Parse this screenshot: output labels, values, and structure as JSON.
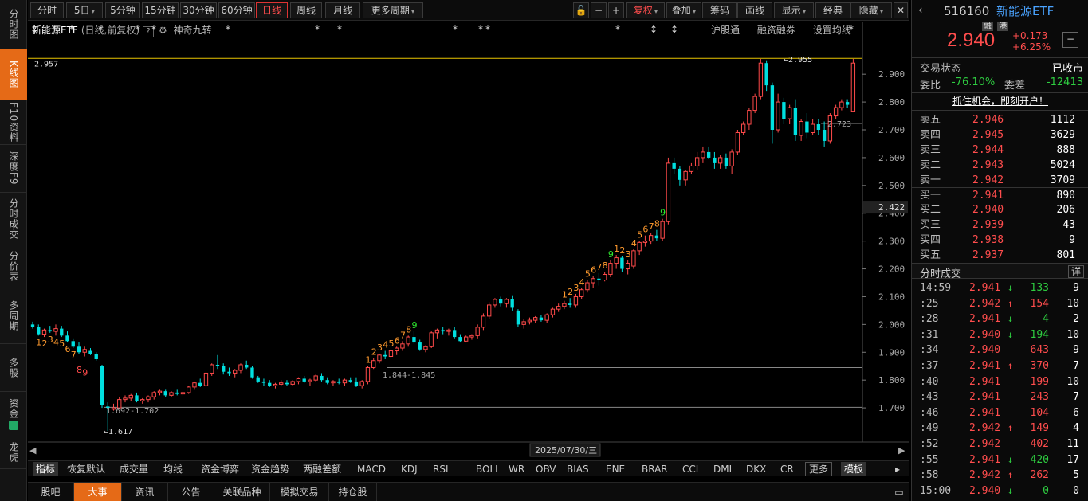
{
  "leftnav": [
    {
      "label": "分时图",
      "active": false,
      "h": 62
    },
    {
      "label": "K线图",
      "active": true,
      "h": 64
    },
    {
      "label": "F10资料",
      "active": false,
      "h": 56
    },
    {
      "label": "深度F9",
      "active": false,
      "h": 60
    },
    {
      "label": "分时成交",
      "active": false,
      "h": 66
    },
    {
      "label": "分价表",
      "active": false,
      "h": 54
    },
    {
      "label": "多周期",
      "active": false,
      "h": 70
    },
    {
      "label": "多股",
      "active": false,
      "h": 60
    },
    {
      "label": "资金",
      "active": false,
      "h": 56
    },
    {
      "label": "龙虎",
      "active": false,
      "h": 41
    }
  ],
  "toolbar": {
    "periods": [
      "分时",
      "5日",
      "5分钟",
      "15分钟",
      "30分钟",
      "60分钟",
      "日线",
      "周线",
      "月线",
      "更多周期"
    ],
    "active_period": "日线",
    "tools": [
      "复权",
      "叠加",
      "筹码",
      "画线",
      "显示",
      "经典",
      "隐藏"
    ]
  },
  "header": {
    "title": "新能源ETF",
    "subtitle": "(日线,前复权)",
    "help": "?",
    "feature": "神奇九转",
    "links": [
      "沪股通",
      "融资融券",
      "设置均线"
    ]
  },
  "chart_data": {
    "type": "candlestick",
    "ylim": [
      1.6,
      2.975
    ],
    "y_ticks": [
      1.7,
      1.8,
      1.9,
      2.0,
      2.1,
      2.2,
      2.3,
      2.4,
      2.5,
      2.6,
      2.7,
      2.8,
      2.9
    ],
    "current_price_label": "2.422",
    "max_label": "2.957",
    "x_label": "2025/07/30/三",
    "annotations": [
      {
        "text": "2.955",
        "type": "high"
      },
      {
        "text": "1.617",
        "type": "low"
      },
      {
        "text": "1.692-1.702",
        "type": "range"
      },
      {
        "text": "1.844-1.845",
        "type": "range"
      },
      {
        "text": "2.723",
        "type": "level"
      }
    ],
    "ohlc": [
      [
        2.0,
        2.01,
        1.985,
        1.99
      ],
      [
        1.99,
        2.0,
        1.96,
        1.965
      ],
      [
        1.965,
        1.985,
        1.955,
        1.98
      ],
      [
        1.98,
        1.995,
        1.97,
        1.975
      ],
      [
        1.975,
        2.0,
        1.96,
        1.985
      ],
      [
        1.985,
        1.995,
        1.955,
        1.96
      ],
      [
        1.96,
        1.975,
        1.935,
        1.94
      ],
      [
        1.94,
        1.95,
        1.915,
        1.92
      ],
      [
        1.92,
        1.935,
        1.895,
        1.9
      ],
      [
        1.9,
        1.92,
        1.885,
        1.91
      ],
      [
        1.905,
        1.915,
        1.89,
        1.895
      ],
      [
        1.895,
        1.9,
        1.87,
        1.875
      ],
      [
        1.85,
        1.855,
        1.7,
        1.71
      ],
      [
        1.705,
        1.72,
        1.617,
        1.7
      ],
      [
        1.695,
        1.715,
        1.69,
        1.7
      ],
      [
        1.7,
        1.74,
        1.695,
        1.73
      ],
      [
        1.73,
        1.745,
        1.72,
        1.735
      ],
      [
        1.735,
        1.75,
        1.725,
        1.745
      ],
      [
        1.745,
        1.755,
        1.72,
        1.725
      ],
      [
        1.725,
        1.735,
        1.715,
        1.73
      ],
      [
        1.73,
        1.745,
        1.72,
        1.74
      ],
      [
        1.74,
        1.76,
        1.73,
        1.755
      ],
      [
        1.755,
        1.765,
        1.745,
        1.76
      ],
      [
        1.76,
        1.765,
        1.74,
        1.745
      ],
      [
        1.745,
        1.76,
        1.74,
        1.755
      ],
      [
        1.755,
        1.765,
        1.745,
        1.75
      ],
      [
        1.75,
        1.76,
        1.742,
        1.755
      ],
      [
        1.755,
        1.78,
        1.75,
        1.775
      ],
      [
        1.775,
        1.795,
        1.765,
        1.79
      ],
      [
        1.79,
        1.805,
        1.775,
        1.78
      ],
      [
        1.78,
        1.83,
        1.775,
        1.825
      ],
      [
        1.825,
        1.86,
        1.815,
        1.855
      ],
      [
        1.855,
        1.89,
        1.84,
        1.85
      ],
      [
        1.85,
        1.86,
        1.82,
        1.83
      ],
      [
        1.83,
        1.845,
        1.815,
        1.825
      ],
      [
        1.825,
        1.84,
        1.81,
        1.835
      ],
      [
        1.835,
        1.86,
        1.825,
        1.855
      ],
      [
        1.855,
        1.87,
        1.84,
        1.845
      ],
      [
        1.845,
        1.85,
        1.805,
        1.81
      ],
      [
        1.81,
        1.815,
        1.79,
        1.795
      ],
      [
        1.795,
        1.805,
        1.78,
        1.79
      ],
      [
        1.79,
        1.8,
        1.775,
        1.78
      ],
      [
        1.78,
        1.79,
        1.77,
        1.785
      ],
      [
        1.785,
        1.8,
        1.778,
        1.79
      ],
      [
        1.79,
        1.8,
        1.78,
        1.785
      ],
      [
        1.785,
        1.8,
        1.778,
        1.795
      ],
      [
        1.795,
        1.81,
        1.785,
        1.805
      ],
      [
        1.805,
        1.815,
        1.79,
        1.795
      ],
      [
        1.795,
        1.805,
        1.78,
        1.8
      ],
      [
        1.8,
        1.82,
        1.795,
        1.815
      ],
      [
        1.815,
        1.825,
        1.795,
        1.8
      ],
      [
        1.8,
        1.81,
        1.785,
        1.79
      ],
      [
        1.79,
        1.8,
        1.78,
        1.795
      ],
      [
        1.795,
        1.805,
        1.785,
        1.79
      ],
      [
        1.79,
        1.805,
        1.78,
        1.8
      ],
      [
        1.8,
        1.81,
        1.79,
        1.795
      ],
      [
        1.795,
        1.81,
        1.775,
        1.78
      ],
      [
        1.78,
        1.8,
        1.77,
        1.795
      ],
      [
        1.795,
        1.85,
        1.785,
        1.845
      ],
      [
        1.845,
        1.88,
        1.84,
        1.87
      ],
      [
        1.87,
        1.895,
        1.86,
        1.89
      ],
      [
        1.89,
        1.905,
        1.875,
        1.885
      ],
      [
        1.885,
        1.91,
        1.88,
        1.905
      ],
      [
        1.905,
        1.92,
        1.89,
        1.915
      ],
      [
        1.915,
        1.94,
        1.905,
        1.93
      ],
      [
        1.93,
        1.96,
        1.92,
        1.955
      ],
      [
        1.955,
        1.975,
        1.93,
        1.935
      ],
      [
        1.935,
        1.945,
        1.905,
        1.91
      ],
      [
        1.91,
        1.925,
        1.9,
        1.92
      ],
      [
        1.92,
        1.975,
        1.915,
        1.97
      ],
      [
        1.97,
        1.985,
        1.95,
        1.98
      ],
      [
        1.98,
        1.99,
        1.965,
        1.975
      ],
      [
        1.975,
        1.985,
        1.96,
        1.98
      ],
      [
        1.98,
        1.99,
        1.95,
        1.955
      ],
      [
        1.955,
        1.965,
        1.935,
        1.94
      ],
      [
        1.94,
        1.96,
        1.935,
        1.955
      ],
      [
        1.955,
        1.965,
        1.945,
        1.96
      ],
      [
        1.96,
        2.0,
        1.95,
        1.99
      ],
      [
        1.99,
        2.04,
        1.98,
        2.03
      ],
      [
        2.03,
        2.08,
        2.02,
        2.07
      ],
      [
        2.07,
        2.095,
        2.06,
        2.09
      ],
      [
        2.09,
        2.1,
        2.065,
        2.075
      ],
      [
        2.075,
        2.095,
        2.06,
        2.09
      ],
      [
        2.09,
        2.105,
        2.05,
        2.06
      ],
      [
        2.05,
        2.055,
        1.99,
        2.0
      ],
      [
        2.0,
        2.02,
        1.985,
        2.01
      ],
      [
        2.01,
        2.025,
        2.0,
        2.015
      ],
      [
        2.015,
        2.03,
        2.005,
        2.025
      ],
      [
        2.025,
        2.035,
        2.01,
        2.015
      ],
      [
        2.015,
        2.04,
        2.005,
        2.035
      ],
      [
        2.035,
        2.06,
        2.025,
        2.055
      ],
      [
        2.055,
        2.075,
        2.045,
        2.065
      ],
      [
        2.065,
        2.085,
        2.055,
        2.075
      ],
      [
        2.075,
        2.095,
        2.06,
        2.07
      ],
      [
        2.07,
        2.11,
        2.06,
        2.1
      ],
      [
        2.1,
        2.13,
        2.09,
        2.125
      ],
      [
        2.125,
        2.16,
        2.115,
        2.15
      ],
      [
        2.15,
        2.175,
        2.13,
        2.165
      ],
      [
        2.165,
        2.185,
        2.14,
        2.16
      ],
      [
        2.16,
        2.19,
        2.155,
        2.18
      ],
      [
        2.18,
        2.23,
        2.17,
        2.22
      ],
      [
        2.22,
        2.25,
        2.2,
        2.24
      ],
      [
        2.24,
        2.245,
        2.19,
        2.2
      ],
      [
        2.2,
        2.23,
        2.18,
        2.22
      ],
      [
        2.21,
        2.27,
        2.2,
        2.265
      ],
      [
        2.265,
        2.3,
        2.25,
        2.295
      ],
      [
        2.295,
        2.32,
        2.28,
        2.3
      ],
      [
        2.3,
        2.33,
        2.29,
        2.32
      ],
      [
        2.32,
        2.34,
        2.3,
        2.31
      ],
      [
        2.31,
        2.38,
        2.3,
        2.37
      ],
      [
        2.37,
        2.6,
        2.36,
        2.58
      ],
      [
        2.58,
        2.6,
        2.54,
        2.56
      ],
      [
        2.56,
        2.57,
        2.5,
        2.52
      ],
      [
        2.52,
        2.555,
        2.5,
        2.55
      ],
      [
        2.55,
        2.58,
        2.54,
        2.57
      ],
      [
        2.57,
        2.62,
        2.555,
        2.6
      ],
      [
        2.6,
        2.64,
        2.58,
        2.62
      ],
      [
        2.62,
        2.64,
        2.595,
        2.6
      ],
      [
        2.6,
        2.62,
        2.56,
        2.58
      ],
      [
        2.58,
        2.61,
        2.56,
        2.6
      ],
      [
        2.6,
        2.615,
        2.56,
        2.57
      ],
      [
        2.57,
        2.63,
        2.54,
        2.62
      ],
      [
        2.62,
        2.7,
        2.61,
        2.69
      ],
      [
        2.69,
        2.73,
        2.68,
        2.72
      ],
      [
        2.72,
        2.78,
        2.7,
        2.77
      ],
      [
        2.77,
        2.83,
        2.76,
        2.82
      ],
      [
        2.82,
        2.955,
        2.81,
        2.94
      ],
      [
        2.94,
        2.95,
        2.84,
        2.86
      ],
      [
        2.86,
        2.87,
        2.65,
        2.7
      ],
      [
        2.7,
        2.83,
        2.69,
        2.8
      ],
      [
        2.8,
        2.815,
        2.72,
        2.74
      ],
      [
        2.74,
        2.79,
        2.72,
        2.78
      ],
      [
        2.78,
        2.81,
        2.66,
        2.68
      ],
      [
        2.68,
        2.74,
        2.66,
        2.73
      ],
      [
        2.73,
        2.76,
        2.67,
        2.69
      ],
      [
        2.69,
        2.74,
        2.68,
        2.72
      ],
      [
        2.72,
        2.74,
        2.68,
        2.7
      ],
      [
        2.7,
        2.73,
        2.64,
        2.66
      ],
      [
        2.66,
        2.76,
        2.65,
        2.75
      ],
      [
        2.75,
        2.79,
        2.74,
        2.78
      ],
      [
        2.78,
        2.81,
        2.77,
        2.8
      ],
      [
        2.8,
        2.81,
        2.78,
        2.79
      ],
      [
        2.767,
        2.955,
        2.767,
        2.94
      ]
    ],
    "nine_turn": [
      {
        "i": 1,
        "t": "1",
        "c": "o"
      },
      {
        "i": 2,
        "t": "2",
        "c": "o"
      },
      {
        "i": 3,
        "t": "3",
        "c": "o"
      },
      {
        "i": 4,
        "t": "4",
        "c": "o"
      },
      {
        "i": 5,
        "t": "5",
        "c": "o"
      },
      {
        "i": 6,
        "t": "6",
        "c": "o"
      },
      {
        "i": 7,
        "t": "7",
        "c": "o"
      },
      {
        "i": 8,
        "t": "8",
        "c": "r"
      },
      {
        "i": 9,
        "t": "9",
        "c": "r"
      },
      {
        "i": 58,
        "t": "1",
        "c": "o"
      },
      {
        "i": 59,
        "t": "2",
        "c": "o"
      },
      {
        "i": 60,
        "t": "3",
        "c": "o"
      },
      {
        "i": 61,
        "t": "4",
        "c": "o"
      },
      {
        "i": 62,
        "t": "5",
        "c": "o"
      },
      {
        "i": 63,
        "t": "6",
        "c": "o"
      },
      {
        "i": 64,
        "t": "7",
        "c": "o"
      },
      {
        "i": 65,
        "t": "8",
        "c": "o"
      },
      {
        "i": 66,
        "t": "9",
        "c": "g"
      },
      {
        "i": 92,
        "t": "1",
        "c": "o"
      },
      {
        "i": 93,
        "t": "2",
        "c": "o"
      },
      {
        "i": 94,
        "t": "3",
        "c": "o"
      },
      {
        "i": 95,
        "t": "4",
        "c": "o"
      },
      {
        "i": 96,
        "t": "5",
        "c": "o"
      },
      {
        "i": 97,
        "t": "6",
        "c": "o"
      },
      {
        "i": 98,
        "t": "7",
        "c": "o"
      },
      {
        "i": 99,
        "t": "8",
        "c": "o"
      },
      {
        "i": 100,
        "t": "9",
        "c": "g"
      },
      {
        "i": 101,
        "t": "1",
        "c": "o"
      },
      {
        "i": 102,
        "t": "2",
        "c": "o"
      },
      {
        "i": 103,
        "t": "3",
        "c": "o"
      },
      {
        "i": 104,
        "t": "4",
        "c": "o"
      },
      {
        "i": 105,
        "t": "5",
        "c": "o"
      },
      {
        "i": 106,
        "t": "6",
        "c": "o"
      },
      {
        "i": 107,
        "t": "7",
        "c": "o"
      },
      {
        "i": 108,
        "t": "8",
        "c": "o"
      },
      {
        "i": 109,
        "t": "9",
        "c": "g"
      }
    ]
  },
  "indicators": [
    "指标",
    "恢复默认",
    "成交量",
    "均线",
    "资金博弈",
    "资金趋势",
    "两融差额",
    "MACD",
    "KDJ",
    "RSI",
    "BOLL",
    "WR",
    "OBV",
    "BIAS",
    "ENE",
    "BRAR",
    "CCI",
    "DMI",
    "DKX",
    "CR",
    "更多",
    "模板"
  ],
  "bottom_tabs": [
    "股吧",
    "大事",
    "资讯",
    "公告",
    "关联品种",
    "模拟交易",
    "持仓股"
  ],
  "active_bottom_tab": "大事",
  "quote": {
    "code": "516160",
    "name": "新能源ETF",
    "badges": [
      "融",
      "港"
    ],
    "price": "2.940",
    "change": "+0.173",
    "change_pct": "+6.25%",
    "status_label": "交易状态",
    "status": "已收市",
    "ratio_label": "委比",
    "ratio": "-76.10%",
    "diff_label": "委差",
    "diff": "-12413",
    "promo": "抓住机会，即刻开户！"
  },
  "orderbook": [
    {
      "label": "卖五",
      "price": "2.946",
      "vol": "1112"
    },
    {
      "label": "卖四",
      "price": "2.945",
      "vol": "3629"
    },
    {
      "label": "卖三",
      "price": "2.944",
      "vol": "888"
    },
    {
      "label": "卖二",
      "price": "2.943",
      "vol": "5024"
    },
    {
      "label": "卖一",
      "price": "2.942",
      "vol": "3709"
    },
    {
      "label": "买一",
      "price": "2.941",
      "vol": "890"
    },
    {
      "label": "买二",
      "price": "2.940",
      "vol": "206"
    },
    {
      "label": "买三",
      "price": "2.939",
      "vol": "43"
    },
    {
      "label": "买四",
      "price": "2.938",
      "vol": "9"
    },
    {
      "label": "买五",
      "price": "2.937",
      "vol": "801"
    }
  ],
  "trades_header": {
    "title": "分时成交",
    "more": "详"
  },
  "trades": [
    {
      "time": "14:59",
      "price": "2.941",
      "dir": "down",
      "vol": "133",
      "n": "9"
    },
    {
      "time": ":25",
      "price": "2.942",
      "dir": "up",
      "vol": "154",
      "n": "10"
    },
    {
      "time": ":28",
      "price": "2.941",
      "dir": "down",
      "vol": "4",
      "n": "2"
    },
    {
      "time": ":31",
      "price": "2.940",
      "dir": "down",
      "vol": "194",
      "n": "10"
    },
    {
      "time": ":34",
      "price": "2.940",
      "dir": "none",
      "vol": "643",
      "n": "9"
    },
    {
      "time": ":37",
      "price": "2.941",
      "dir": "up",
      "vol": "370",
      "n": "7"
    },
    {
      "time": ":40",
      "price": "2.941",
      "dir": "none",
      "vol": "199",
      "n": "10"
    },
    {
      "time": ":43",
      "price": "2.941",
      "dir": "none",
      "vol": "243",
      "n": "7"
    },
    {
      "time": ":46",
      "price": "2.941",
      "dir": "none",
      "vol": "104",
      "n": "6"
    },
    {
      "time": ":49",
      "price": "2.942",
      "dir": "up",
      "vol": "149",
      "n": "4"
    },
    {
      "time": ":52",
      "price": "2.942",
      "dir": "none",
      "vol": "402",
      "n": "11"
    },
    {
      "time": ":55",
      "price": "2.941",
      "dir": "down",
      "vol": "420",
      "n": "17"
    },
    {
      "time": ":58",
      "price": "2.942",
      "dir": "up",
      "vol": "262",
      "n": "5"
    },
    {
      "time": "15:00",
      "price": "2.940",
      "dir": "down",
      "vol": "0",
      "n": "0"
    }
  ]
}
